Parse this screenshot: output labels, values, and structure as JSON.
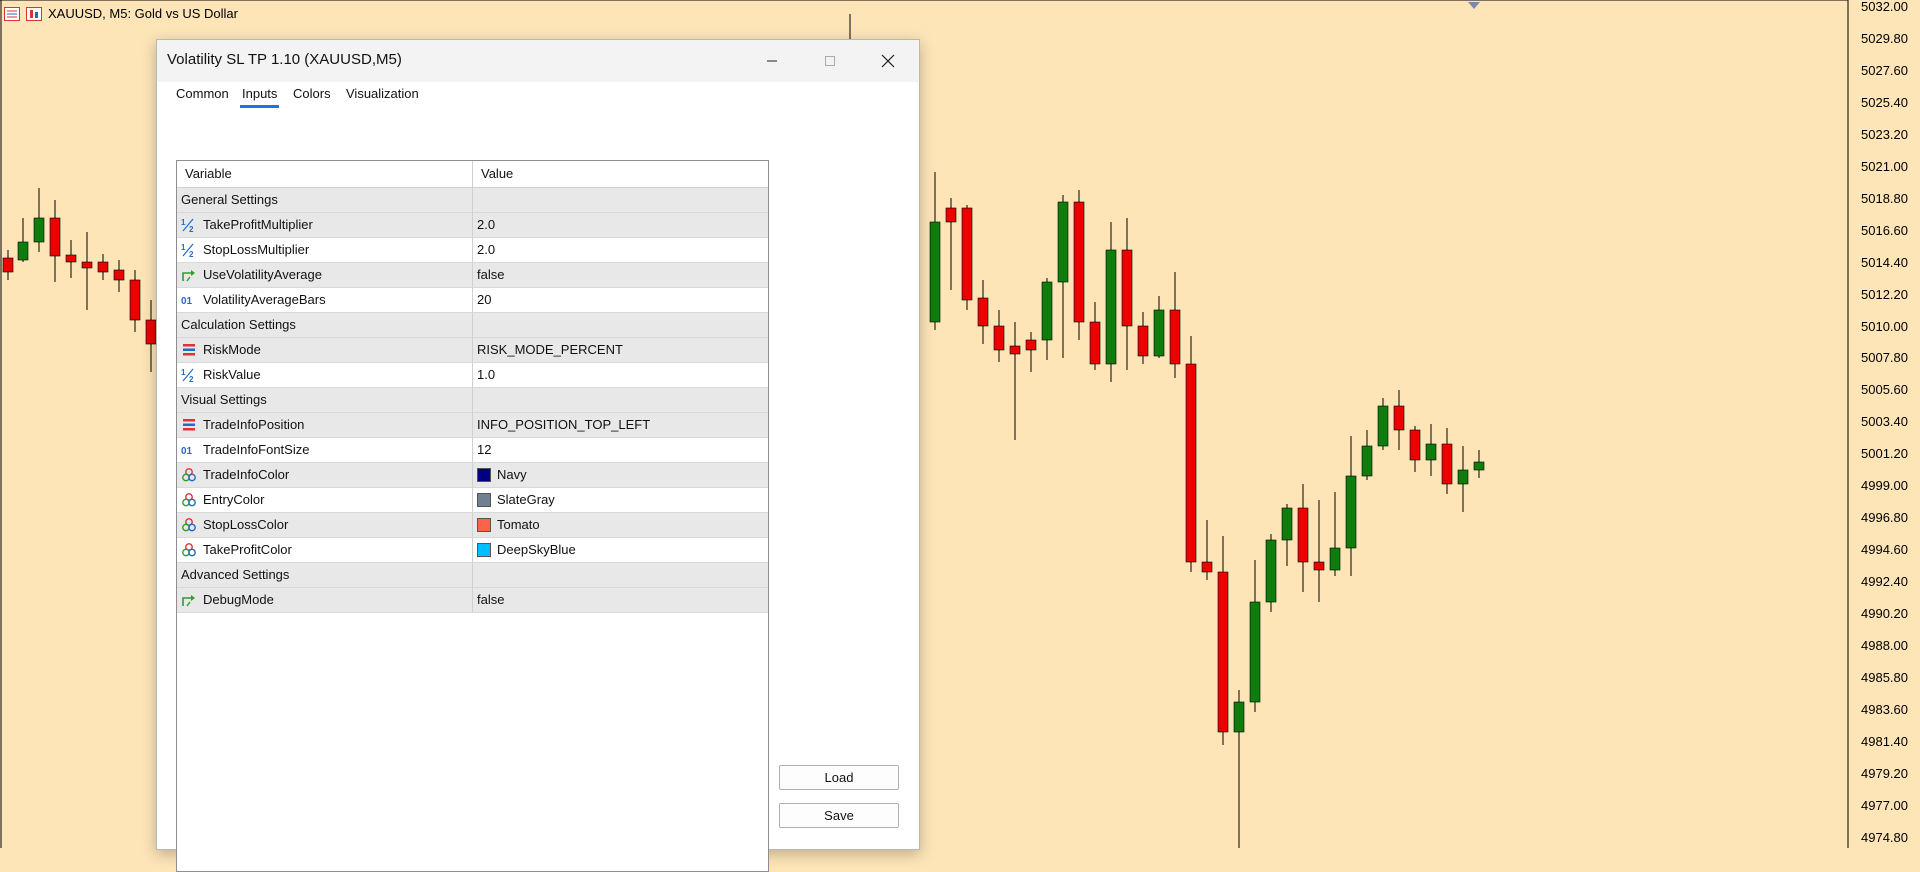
{
  "chart": {
    "title": "XAUUSD, M5:  Gold vs US Dollar",
    "price_labels": [
      "5032.00",
      "5029.80",
      "5027.60",
      "5025.40",
      "5023.20",
      "5021.00",
      "5018.80",
      "5016.60",
      "5014.40",
      "5012.20",
      "5010.00",
      "5007.80",
      "5005.60",
      "5003.40",
      "5001.20",
      "4999.00",
      "4996.80",
      "4994.60",
      "4992.40",
      "4990.20",
      "4988.00",
      "4985.80",
      "4983.60",
      "4981.40",
      "4979.20",
      "4977.00",
      "4974.80"
    ],
    "colors": {
      "background": "#fde5b8",
      "bull": "#0e7d0e",
      "bear": "#ee0000",
      "wick": "#000000"
    }
  },
  "dialog": {
    "title": "Volatility SL TP 1.10 (XAUUSD,M5)",
    "tabs": [
      "Common",
      "Inputs",
      "Colors",
      "Visualization"
    ],
    "active_tab": "Inputs",
    "headers": {
      "variable": "Variable",
      "value": "Value"
    },
    "rows": [
      {
        "type": "section",
        "label": "General Settings"
      },
      {
        "type": "param",
        "icon": "fraction-icon",
        "name": "TakeProfitMultiplier",
        "value": "2.0"
      },
      {
        "type": "param",
        "icon": "fraction-icon",
        "name": "StopLossMultiplier",
        "value": "2.0"
      },
      {
        "type": "param",
        "icon": "bool-arrow-icon",
        "name": "UseVolatilityAverage",
        "value": "false"
      },
      {
        "type": "param",
        "icon": "integer-icon",
        "name": "VolatilityAverageBars",
        "value": "20"
      },
      {
        "type": "section",
        "label": "Calculation Settings"
      },
      {
        "type": "param",
        "icon": "enum-list-icon",
        "name": "RiskMode",
        "value": "RISK_MODE_PERCENT"
      },
      {
        "type": "param",
        "icon": "fraction-icon",
        "name": "RiskValue",
        "value": "1.0"
      },
      {
        "type": "section",
        "label": "Visual Settings"
      },
      {
        "type": "param",
        "icon": "enum-list-icon",
        "name": "TradeInfoPosition",
        "value": "INFO_POSITION_TOP_LEFT"
      },
      {
        "type": "param",
        "icon": "integer-icon",
        "name": "TradeInfoFontSize",
        "value": "12"
      },
      {
        "type": "param",
        "icon": "color-circles-icon",
        "name": "TradeInfoColor",
        "value": "Navy",
        "swatch": "#000080"
      },
      {
        "type": "param",
        "icon": "color-circles-icon",
        "name": "EntryColor",
        "value": "SlateGray",
        "swatch": "#708090"
      },
      {
        "type": "param",
        "icon": "color-circles-icon",
        "name": "StopLossColor",
        "value": "Tomato",
        "swatch": "#ff6347"
      },
      {
        "type": "param",
        "icon": "color-circles-icon",
        "name": "TakeProfitColor",
        "value": "DeepSkyBlue",
        "swatch": "#00bfff"
      },
      {
        "type": "section",
        "label": "Advanced Settings"
      },
      {
        "type": "param",
        "icon": "bool-arrow-icon",
        "name": "DebugMode",
        "value": "false"
      }
    ],
    "buttons": {
      "load": "Load",
      "save": "Save"
    }
  }
}
